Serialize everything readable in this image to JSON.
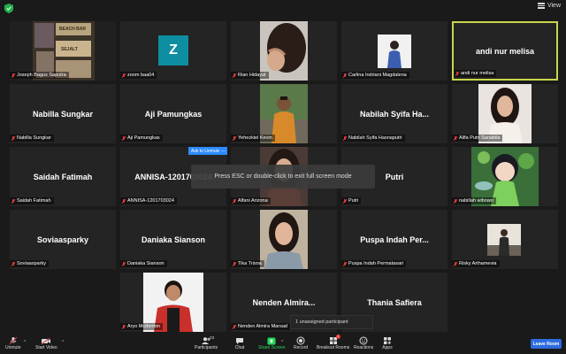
{
  "topbar": {
    "view_label": "View"
  },
  "tiles": [
    {
      "id": "t1",
      "label": "Joseph Bagus Saputra",
      "type": "photo-beach",
      "photo_text": [
        "BEACH BAR",
        "SEJALT"
      ]
    },
    {
      "id": "t2",
      "label": "zoom baa04",
      "type": "avatar",
      "avatar_letter": "Z",
      "avatar_color": "#0e8ea1"
    },
    {
      "id": "t3",
      "label": "Rian Hidayat",
      "type": "photo-hair"
    },
    {
      "id": "t4",
      "label": "Carlina Indriani Magdalena",
      "type": "photo-small"
    },
    {
      "id": "t5",
      "label": "andi nur melisa",
      "type": "name",
      "center_name": "andi nur melisa",
      "active": true
    },
    {
      "id": "t6",
      "label": "Nabilla Sungkar",
      "type": "name",
      "center_name": "Nabilla Sungkar"
    },
    {
      "id": "t7",
      "label": "Aji Pamungkas",
      "type": "name",
      "center_name": "Aji Pamungkas"
    },
    {
      "id": "t8",
      "label": "Yehezkiel Kevin",
      "type": "photo-man"
    },
    {
      "id": "t9",
      "label": "Nabilah Syifa Hasnaputri",
      "type": "name",
      "center_name": "Nabilah Syifa Ha..."
    },
    {
      "id": "t10",
      "label": "Alifa Putri Sanabila",
      "type": "photo-woman"
    },
    {
      "id": "t11",
      "label": "Saidah Fatimah",
      "type": "name",
      "center_name": "Saidah Fatimah"
    },
    {
      "id": "t12",
      "label": "ANNISA-1201703024",
      "type": "name",
      "center_name": "ANNISA-1201703024"
    },
    {
      "id": "t13",
      "label": "Alfani Arizona",
      "type": "photo-woman2"
    },
    {
      "id": "t14",
      "label": "Putri",
      "type": "name",
      "center_name": "Putri"
    },
    {
      "id": "t15",
      "label": "nabillah wibowo",
      "type": "photo-fairy"
    },
    {
      "id": "t16",
      "label": "Soviaasparky",
      "type": "name",
      "center_name": "Soviaasparky"
    },
    {
      "id": "t17",
      "label": "Daniaka Sianson",
      "type": "name",
      "center_name": "Daniaka Sianson"
    },
    {
      "id": "t18",
      "label": "Tika Trisna",
      "type": "photo-woman3"
    },
    {
      "id": "t19",
      "label": "Puspa Indah Permatasari",
      "type": "name",
      "center_name": "Puspa Indah Per..."
    },
    {
      "id": "t20",
      "label": "Risky Arthamevia",
      "type": "photo-small2"
    },
    {
      "id": "t21",
      "label": "Aryo Mcdonton",
      "type": "photo-man2"
    },
    {
      "id": "t22",
      "label": "Nenden Almira Marsad",
      "type": "name",
      "center_name": "Nenden Almira..."
    },
    {
      "id": "t23",
      "label": "",
      "type": "name",
      "center_name": "Thania Safiera"
    }
  ],
  "overlay": {
    "ask_unmute": "Ask to Unmute",
    "ask_unmute_more": "...",
    "fullscreen_toast": "Press ESC or double-click to exit full screen mode",
    "unassigned": "1 unassigned participant"
  },
  "toolbar": {
    "unmute": "Unmute",
    "start_video": "Start Video",
    "participants": "Participants",
    "participants_count": "23",
    "chat": "Chat",
    "share_screen": "Share Screen",
    "record": "Record",
    "breakout_rooms": "Breakout Rooms",
    "breakout_badge": "1",
    "reactions": "Reactions",
    "apps": "Apps",
    "leave": "Leave Room"
  },
  "colors": {
    "active_border": "#c8d64a",
    "accent_blue": "#2d8cff",
    "share_green": "#23d959",
    "muted_red": "#e03a3a"
  }
}
